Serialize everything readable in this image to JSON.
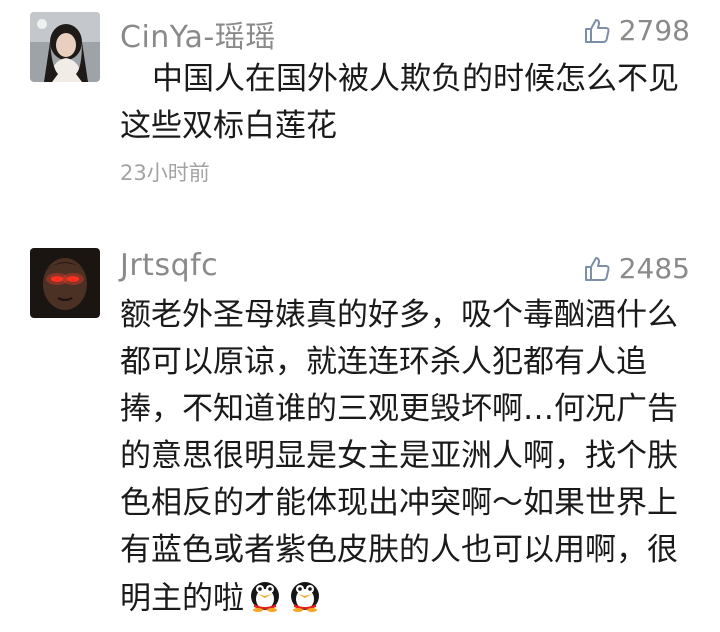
{
  "comments": [
    {
      "username": "CinYa-瑶瑶",
      "likes": "2798",
      "text": "中国人在国外被人欺负的时候怎么不见这些双标白莲花",
      "time": "23小时前",
      "avatar_icon": "user-avatar-girl-icon"
    },
    {
      "username": "Jrtsqfc",
      "likes": "2485",
      "text": "额老外圣母婊真的好多，吸个毒酗酒什么都可以原谅，就连连环杀人犯都有人追捧，不知道谁的三观更毁坏啊…何况广告的意思很明显是女主是亚洲人啊，找个肤色相反的才能体现出冲突啊～如果世界上有蓝色或者紫色皮肤的人也可以用啊，很明主的啦",
      "avatar_icon": "user-avatar-red-eyes-icon",
      "emojis": [
        "penguin-emoji-icon",
        "penguin-emoji-icon"
      ]
    }
  ],
  "colors": {
    "username": "#8a8a8a",
    "text": "#1a1a1a",
    "meta": "#a3a3a3"
  }
}
